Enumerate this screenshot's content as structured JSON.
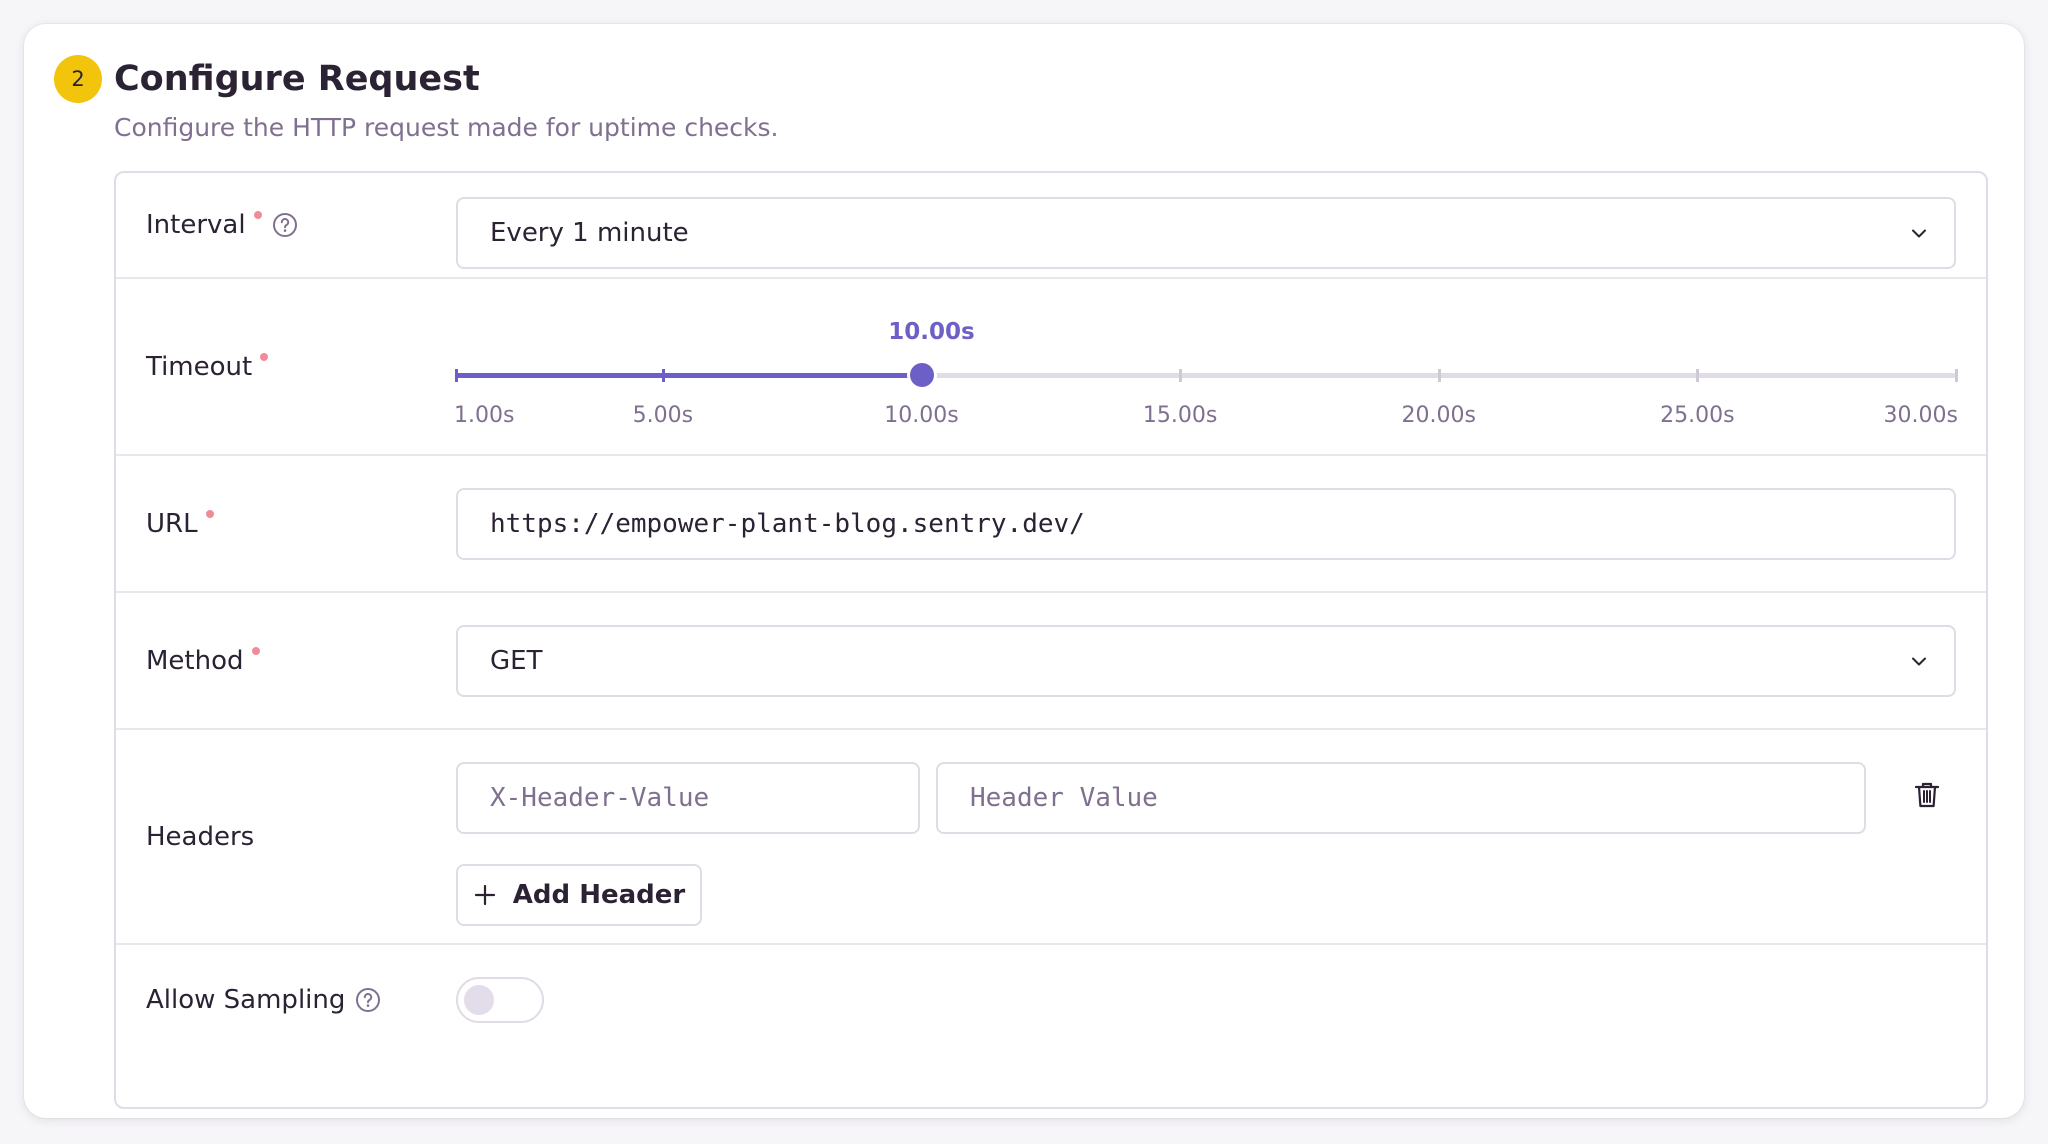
{
  "section": {
    "step_number": "2",
    "title": "Configure Request",
    "description": "Configure the HTTP request made for uptime checks."
  },
  "fields": {
    "interval": {
      "label": "Interval",
      "required": true,
      "has_help": true,
      "selected_value": "Every 1 minute"
    },
    "timeout": {
      "label": "Timeout",
      "required": true,
      "value_label": "10.00s",
      "value": 10,
      "min": 1,
      "max": 30,
      "ticks": [
        {
          "value": 1,
          "label": "1.00s"
        },
        {
          "value": 5,
          "label": "5.00s"
        },
        {
          "value": 10,
          "label": "10.00s"
        },
        {
          "value": 15,
          "label": "15.00s"
        },
        {
          "value": 20,
          "label": "20.00s"
        },
        {
          "value": 25,
          "label": "25.00s"
        },
        {
          "value": 30,
          "label": "30.00s"
        }
      ]
    },
    "url": {
      "label": "URL",
      "required": true,
      "value": "https://empower-plant-blog.sentry.dev/"
    },
    "method": {
      "label": "Method",
      "required": true,
      "selected_value": "GET"
    },
    "headers": {
      "label": "Headers",
      "name_placeholder": "X-Header-Value",
      "value_placeholder": "Header Value",
      "add_label": "Add Header"
    },
    "allow_sampling": {
      "label": "Allow Sampling",
      "has_help": true,
      "enabled": false
    }
  },
  "colors": {
    "accent": "#6c5fc7",
    "badge": "#f2c40b",
    "required_dot": "#f18b97",
    "muted_text": "#80708f",
    "border": "#e0dce5"
  },
  "icons": [
    "question-circle-icon",
    "chevron-down-icon",
    "trash-icon",
    "plus-icon"
  ]
}
